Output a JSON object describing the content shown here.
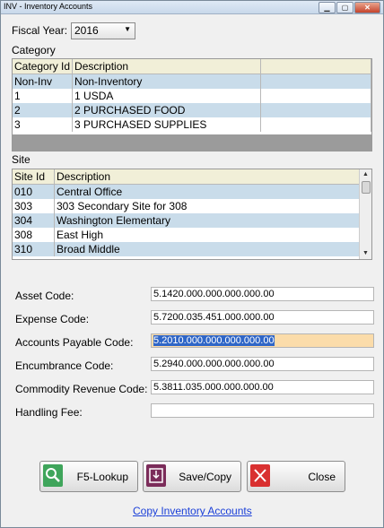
{
  "window": {
    "title": "INV - Inventory Accounts"
  },
  "fiscal_year": {
    "label": "Fiscal Year:",
    "value": "2016"
  },
  "category": {
    "label": "Category",
    "columns": [
      "Category Id",
      "Description"
    ],
    "rows": [
      [
        "Non-Inv",
        "Non-Inventory"
      ],
      [
        "1",
        "1 USDA"
      ],
      [
        "2",
        "2 PURCHASED FOOD"
      ],
      [
        "3",
        "3 PURCHASED SUPPLIES"
      ]
    ]
  },
  "site": {
    "label": "Site",
    "columns": [
      "Site Id",
      "Description"
    ],
    "rows": [
      [
        "010",
        "Central Office"
      ],
      [
        "303",
        "303 Secondary Site for 308"
      ],
      [
        "304",
        "Washington Elementary"
      ],
      [
        "308",
        "East High"
      ],
      [
        "310",
        "Broad Middle"
      ]
    ]
  },
  "accounts": {
    "asset_label": "Asset Code:",
    "asset_value": "5.1420.000.000.000.000.00",
    "expense_label": "Expense Code:",
    "expense_value": "5.7200.035.451.000.000.00",
    "ap_label": "Accounts Payable Code:",
    "ap_value": "5.2010.000.000.000.000.00",
    "encumbrance_label": "Encumbrance Code:",
    "encumbrance_value": "5.2940.000.000.000.000.00",
    "commodity_label": "Commodity Revenue Code:",
    "commodity_value": "5.3811.035.000.000.000.00",
    "handling_label": "Handling Fee:",
    "handling_value": ""
  },
  "buttons": {
    "lookup": "F5-Lookup",
    "save": "Save/Copy",
    "close": "Close"
  },
  "link": {
    "copy": "Copy Inventory Accounts"
  },
  "colors": {
    "row_alt": "#c9dcea",
    "header": "#f1efd8",
    "highlight": "#fbdcaa",
    "link": "#1a3fd8"
  }
}
